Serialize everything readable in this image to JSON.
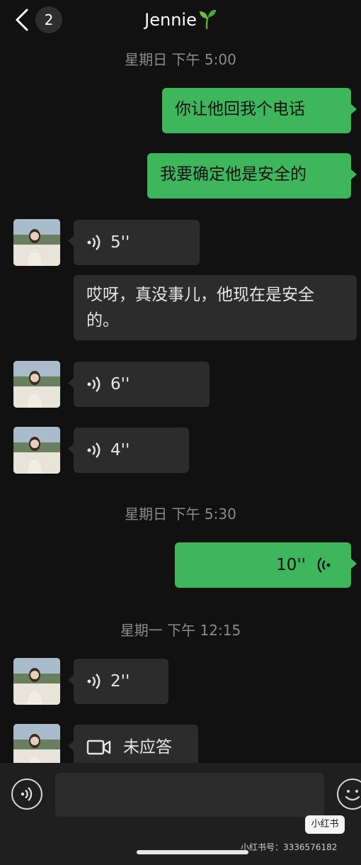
{
  "header": {
    "back_badge": "2",
    "title": "Jennie"
  },
  "timestamps": [
    "星期日 下午 5:00",
    "星期日 下午 5:30",
    "星期一 下午 12:15"
  ],
  "messages": {
    "m1": {
      "text": "你让他回我个电话"
    },
    "m2": {
      "text": "我要确定他是安全的"
    },
    "m3": {
      "duration": "5''"
    },
    "m4": {
      "text": "哎呀，真没事儿，他现在是安全的。"
    },
    "m5": {
      "duration": "6''"
    },
    "m6": {
      "duration": "4''"
    },
    "m7": {
      "duration": "10''"
    },
    "m8": {
      "duration": "2''"
    },
    "m9": {
      "text": "未应答"
    }
  },
  "watermark": {
    "logo": "小红书",
    "id": "小红书号：3336576182"
  },
  "icons": [
    "back-chevron-icon",
    "sprout-icon",
    "voice-wave-icon",
    "video-call-icon",
    "voice-input-icon",
    "emoji-icon"
  ],
  "colors": {
    "outgoing": "#3eb65b",
    "incoming": "#2c2c2c",
    "background": "#111111"
  }
}
